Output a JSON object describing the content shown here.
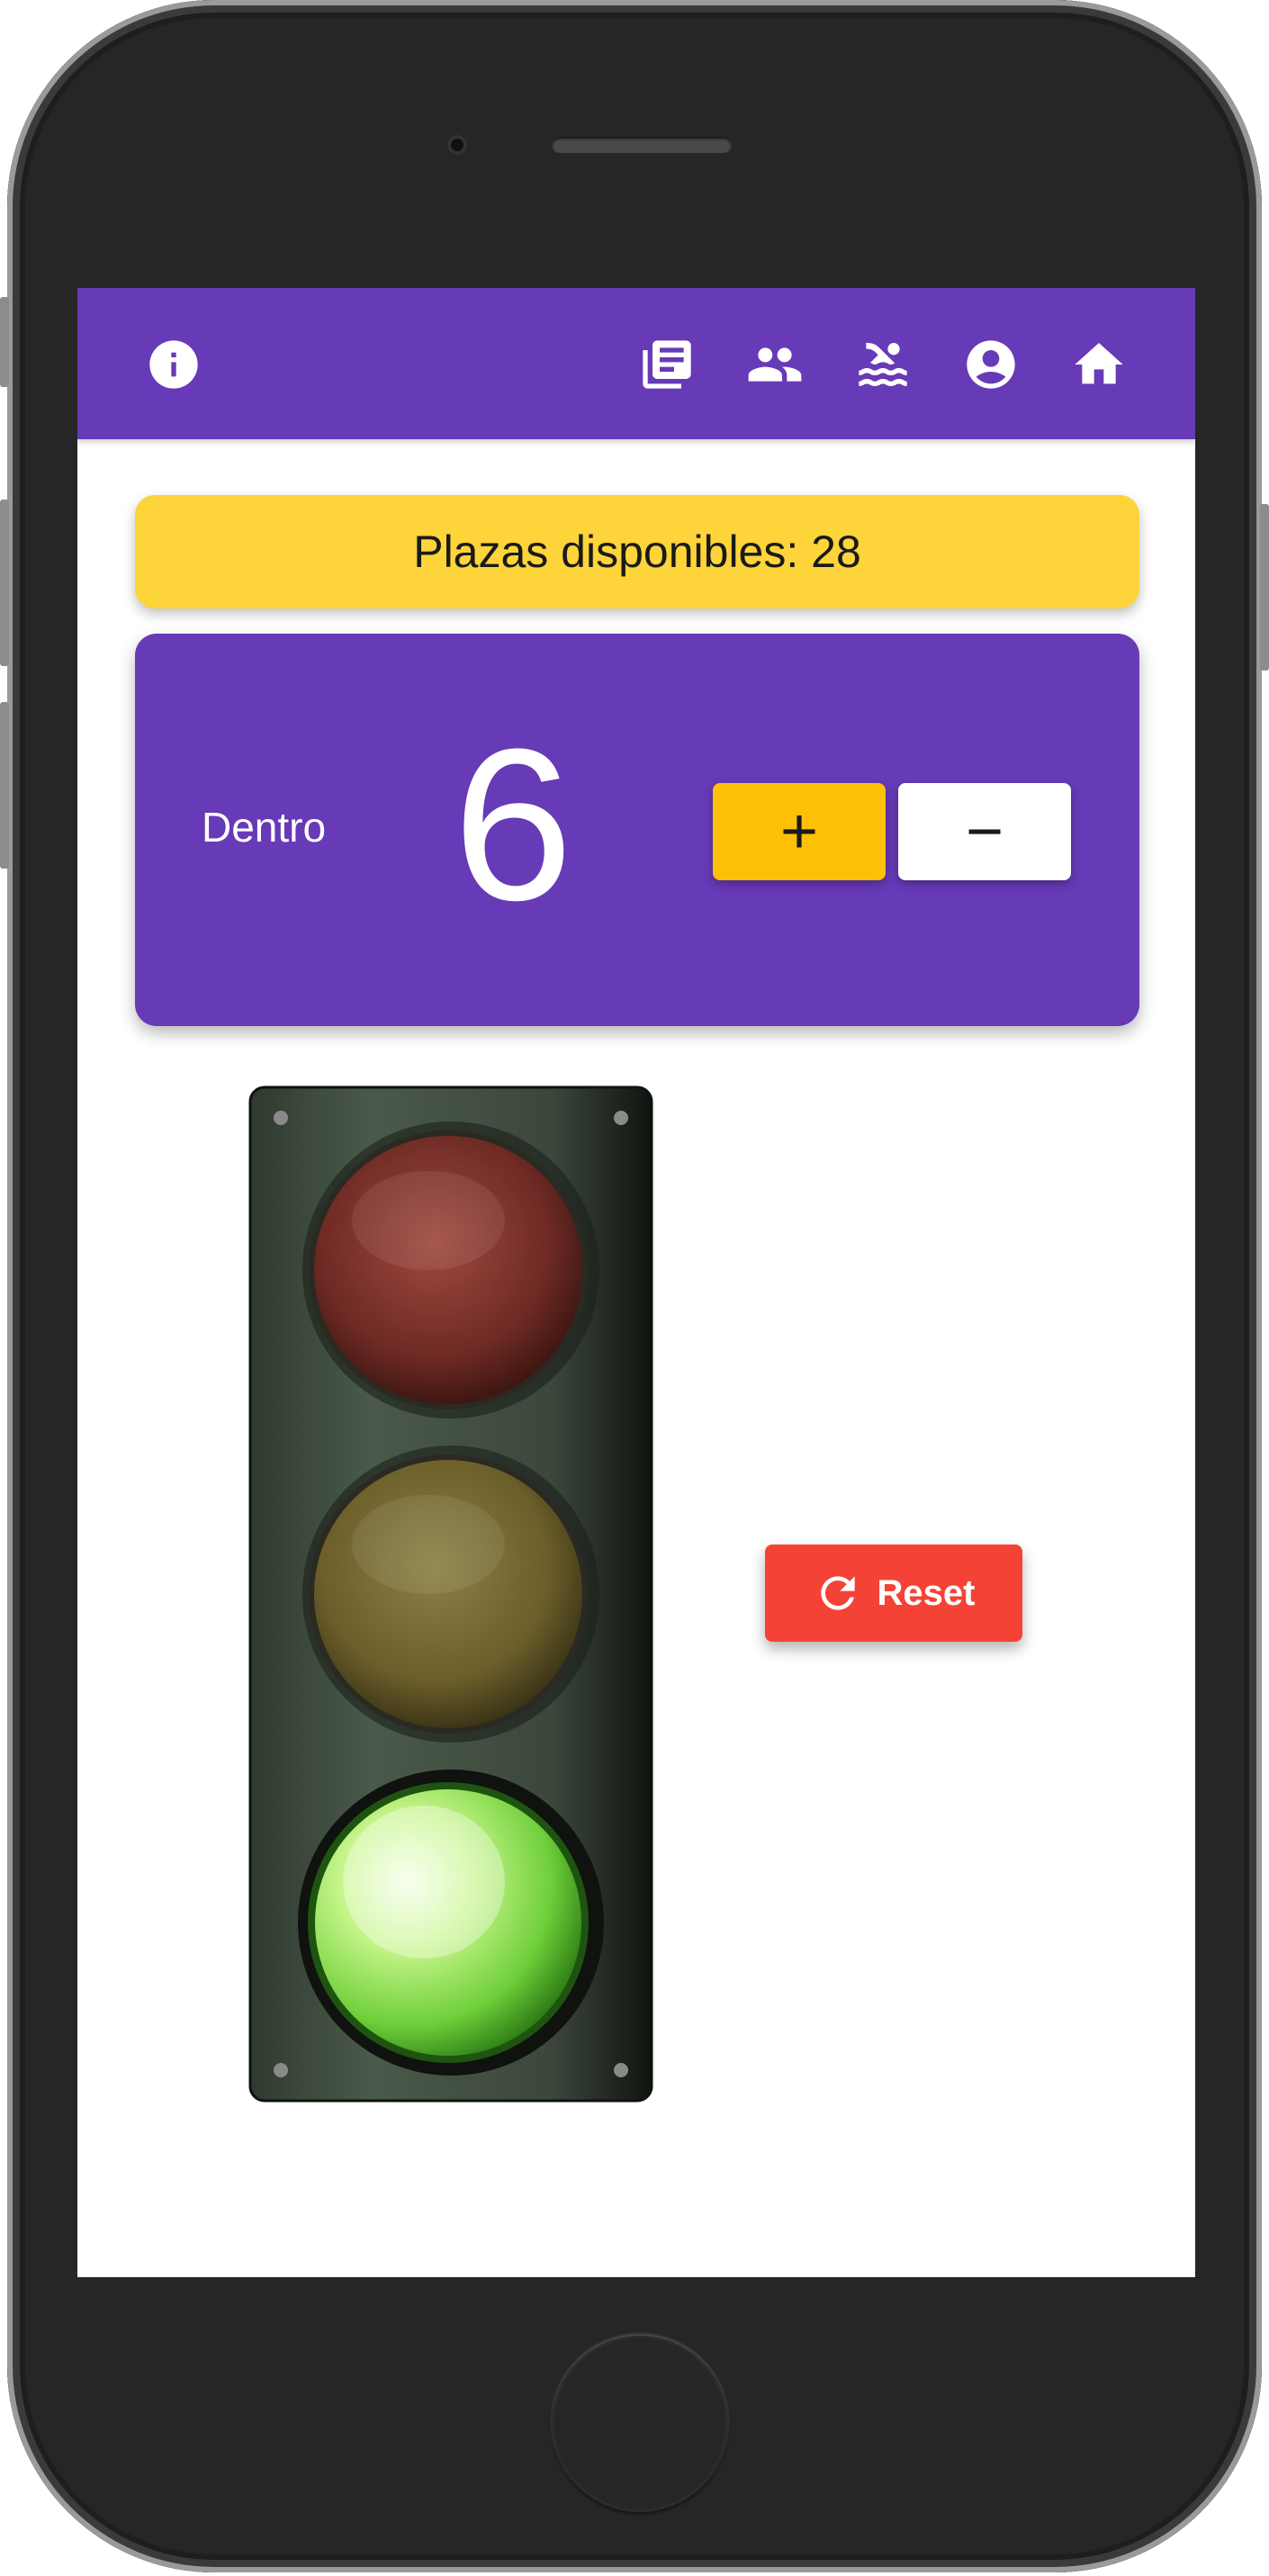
{
  "appbar": {
    "background": "#673ab7",
    "left_icon": "info-icon",
    "right_icons": [
      "news-icon",
      "people-icon",
      "pool-icon",
      "account-icon",
      "home-icon"
    ]
  },
  "banner": {
    "text": "Plazas disponibles: 28",
    "background": "#fdd43a"
  },
  "counter": {
    "label": "Dentro",
    "value": "6",
    "plus_label": "+",
    "minus_label": "−"
  },
  "traffic_light": {
    "active": "green",
    "lamps": [
      "red",
      "yellow",
      "green"
    ]
  },
  "reset": {
    "label": "Reset",
    "icon": "refresh-icon",
    "color": "#f44336"
  }
}
